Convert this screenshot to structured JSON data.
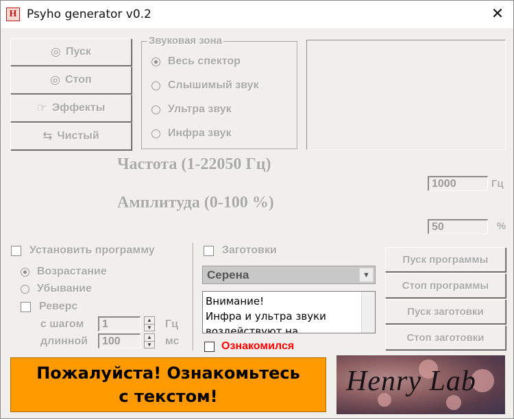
{
  "window": {
    "title": "Psyho generator v0.2",
    "app_icon": "H",
    "close_glyph": "✕"
  },
  "main_buttons": [
    {
      "label": "Пуск",
      "icon": "◎"
    },
    {
      "label": "Стоп",
      "icon": "◎"
    },
    {
      "label": "Эффекты",
      "icon": "☞"
    },
    {
      "label": "Чистый",
      "icon": "⇆"
    }
  ],
  "sound_zone": {
    "title": "Звуковая зона",
    "options": [
      "Весь спектор",
      "Слышимый звук",
      "Ультра звук",
      "Инфра звук"
    ],
    "selected": 0
  },
  "frequency": {
    "label": "Частота (1-22050 Гц)",
    "value": "1000",
    "unit": "Гц"
  },
  "amplitude": {
    "label": "Амплитуда (0-100 %)",
    "value": "50",
    "unit": "%"
  },
  "program": {
    "checkbox_label": "Установить программу",
    "ascending": "Возрастание",
    "descending": "Убывание",
    "reverse": "Реверс",
    "step_label": "с шагом",
    "step_value": "1",
    "step_unit": "Гц",
    "length_label": "длинной",
    "length_value": "100",
    "length_unit": "мс"
  },
  "presets": {
    "checkbox_label": "Заготовки",
    "selected_preset": "Серена",
    "notice_lines": [
      "Внимание!",
      "Инфра и ультра звуки",
      "воздействуют на"
    ],
    "agree_label": "Ознакомился"
  },
  "right_buttons": [
    "Пуск программы",
    "Стоп программы",
    "Пуск заготовки",
    "Стоп заготовки"
  ],
  "banner": {
    "line1": "Пожалуйста! Ознакомьтесь",
    "line2": "с текстом!"
  },
  "logo": {
    "text": "Henry  Lab"
  },
  "colors": {
    "banner_bg": "#ff9900",
    "agree_text": "#ff0000",
    "disabled_text": "#a9a9a9"
  }
}
